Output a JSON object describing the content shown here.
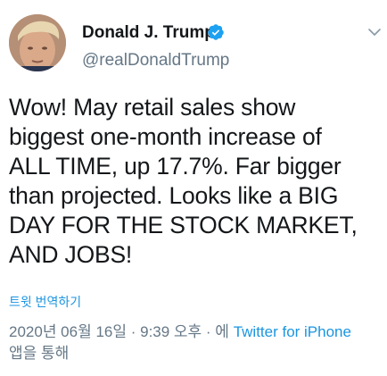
{
  "user": {
    "display_name": "Donald J. Trump",
    "handle": "@realDonaldTrump",
    "verified": true
  },
  "tweet": {
    "text": "Wow! May retail sales show\nbiggest one-month increase of\nALL TIME, up 17.7%. Far bigger\nthan projected. Looks like a BIG\nDAY FOR THE STOCK MARKET,\nAND JOBS!"
  },
  "translate_label": "트윗 번역하기",
  "meta": {
    "timestamp": "2020년 06월 16일 · 9:39 오후 · 에",
    "source": "Twitter for iPhone",
    "suffix": "앱을 통해"
  },
  "colors": {
    "link": "#1b95e0",
    "secondary_text": "#657786",
    "verified_badge": "#1da1f2"
  },
  "icons": {
    "verified": "verified-badge-icon",
    "caret": "chevron-down-icon"
  }
}
